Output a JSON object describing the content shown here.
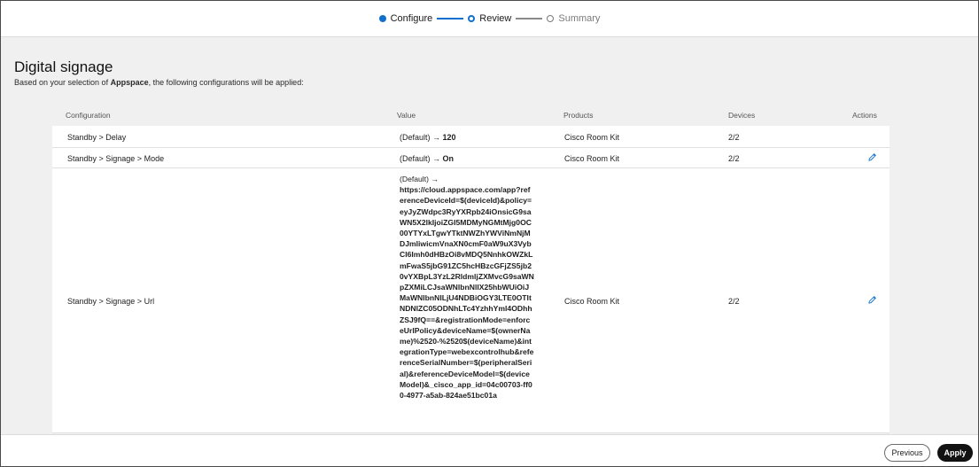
{
  "stepper": {
    "steps": [
      {
        "label": "Configure",
        "state": "done"
      },
      {
        "label": "Review",
        "state": "current"
      },
      {
        "label": "Summary",
        "state": "todo"
      }
    ]
  },
  "header": {
    "title": "Digital signage",
    "subtitle_prefix": "Based on your selection of ",
    "subtitle_app": "Appspace",
    "subtitle_suffix": ", the following configurations will be applied:"
  },
  "table": {
    "columns": [
      "Configuration",
      "Value",
      "Products",
      "Devices",
      "Actions"
    ],
    "rows": [
      {
        "config": "Standby > Delay",
        "value_prefix": "(Default) → ",
        "value": "120",
        "product": "Cisco Room Kit",
        "devices": "2/2",
        "editable": false
      },
      {
        "config": "Standby > Signage > Mode",
        "value_prefix": "(Default) → ",
        "value": "On",
        "product": "Cisco Room Kit",
        "devices": "2/2",
        "editable": true
      },
      {
        "config": "Standby > Signage > Url",
        "value_prefix": "(Default) →",
        "value": "https://cloud.appspace.com/app?referenceDeviceId=$(deviceId)&policy=eyJyZWdpc3RyYXRpb24iOnsicG9saWN5X2lkIjoiZGI5MDMyNGMtMjg0OC00YTYxLTgwYTktNWZhYWViNmNjMDJmliwicmVnaXN0cmF0aW9uX3VybCI6Imh0dHBzOi8vMDQ5NnhkOWZkLmFwaS5jbG91ZC5hcHBzcGFjZS5jb20vYXBpL3YzL2RldmljZXMvcG9saWNpZXMiLCJsaWNlbnNlIX25hbWUiOiJMaWNlbnNlLjU4NDBiOGY3LTE0OTItNDNIZC05ODNhLTc4YzhhYml4ODhhZSJ9fQ==&registrationMode=enforceUrlPolicy&deviceName=$(ownerName)%2520-%2520$(deviceName)&integrationType=webexcontrolhub&referenceSerialNumber=$(peripheralSerial)&referenceDeviceModel=$(deviceModel)&_cisco_app_id=04c00703-ff00-4977-a5ab-824ae51bc01a",
        "product": "Cisco Room Kit",
        "devices": "2/2",
        "editable": true
      }
    ]
  },
  "footer": {
    "previous_label": "Previous",
    "apply_label": "Apply"
  },
  "colors": {
    "accent": "#1170cf",
    "primary_button": "#121212",
    "page_background": "#f0f0f0"
  },
  "icons": {
    "edit": "pencil-icon"
  }
}
